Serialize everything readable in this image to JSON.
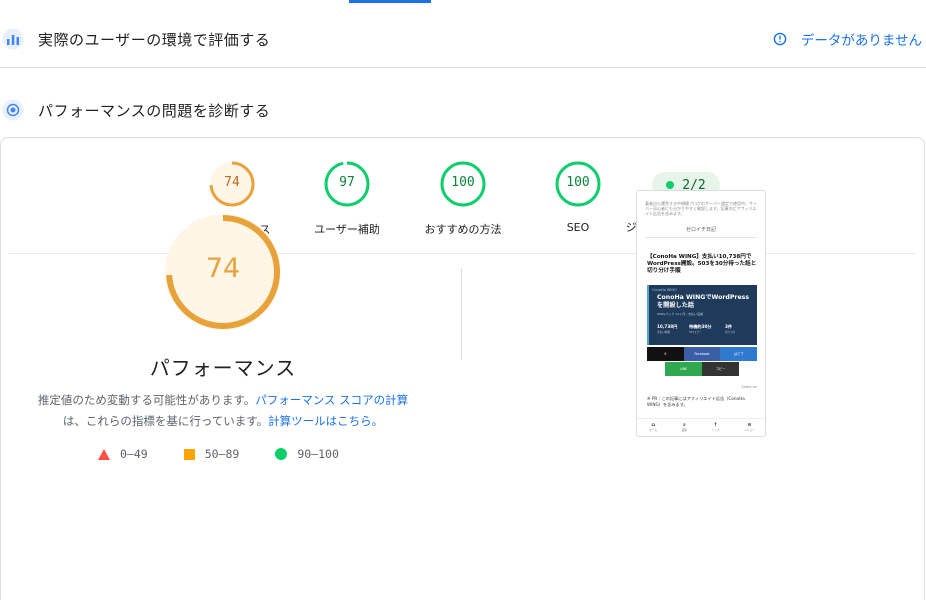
{
  "sections": {
    "field": {
      "title": "実際のユーザーの環境で評価する",
      "no_data": "データがありません"
    },
    "diagnose": {
      "title": "パフォーマンスの問題を診断する"
    }
  },
  "gauges": [
    {
      "score": "74",
      "label": "パフォーマンス",
      "status": "average",
      "fraction": 0.74
    },
    {
      "score": "97",
      "label": "ユーザー補助",
      "status": "pass",
      "fraction": 0.97
    },
    {
      "score": "100",
      "label": "おすすめの方法",
      "status": "pass",
      "fraction": 1.0
    },
    {
      "score": "100",
      "label": "SEO",
      "status": "pass",
      "fraction": 1.0
    }
  ],
  "agent": {
    "pill": "2/2",
    "label": "ジェントによるブラウジ"
  },
  "main": {
    "score": "74",
    "fraction": 0.74,
    "title": "パフォーマンス",
    "desc_1": "推定値のため変動する可能性があります。",
    "desc_link_1": "パフォーマンス スコアの計算",
    "desc_2": "は、これらの指標を基に行っています。",
    "desc_link_2": "計算ツールはこちら。"
  },
  "legend": {
    "fail": "0–49",
    "average": "50–89",
    "pass": "90–100"
  },
  "thumbnail": {
    "intro": "著者自ら運営する中規模ブログのサーバー選定で使用中。サーバー初心者にも分かりやすく解説します。記事内にアフィリエイト広告を含みます。",
    "site_name": "ゼロイチ日記",
    "article_title": "【ConoHa WING】支払い10,738円でWordPress開設。503を30分待った話と切り分け手順",
    "hero_tag": "ConoHa WING",
    "hero_title": "ConoHa WINGでWordPressを開設した話",
    "hero_sub": "WINGパック 12ヶ月 / 支払い実績",
    "stat1": "10,738円",
    "stat1_sub": "支払い総額",
    "stat2": "待機約30分",
    "stat2_sub": "503エラー",
    "stat3": "3件",
    "stat3_sub": "切り分け",
    "btn_x": "X",
    "btn_fb": "Facebook",
    "btn_hb": "はてブ",
    "btn_line": "LINE",
    "btn_copy": "コピー",
    "small": "Share on",
    "note": "※ PR｜この記事にはアフィリエイト広告（ConoHa WING）を含みます。",
    "nav": [
      {
        "icon": "⌂",
        "label": "ホーム"
      },
      {
        "icon": "⌕",
        "label": "検索"
      },
      {
        "icon": "↑",
        "label": "トップ"
      },
      {
        "icon": "≡",
        "label": "メニュー"
      }
    ]
  },
  "colors": {
    "average": "#e8a23a",
    "average_bg": "#fff6e8",
    "pass": "#0cce6b",
    "pass_text": "#08863d",
    "pass_bg": "#ffffff",
    "link": "#1a73e8"
  }
}
